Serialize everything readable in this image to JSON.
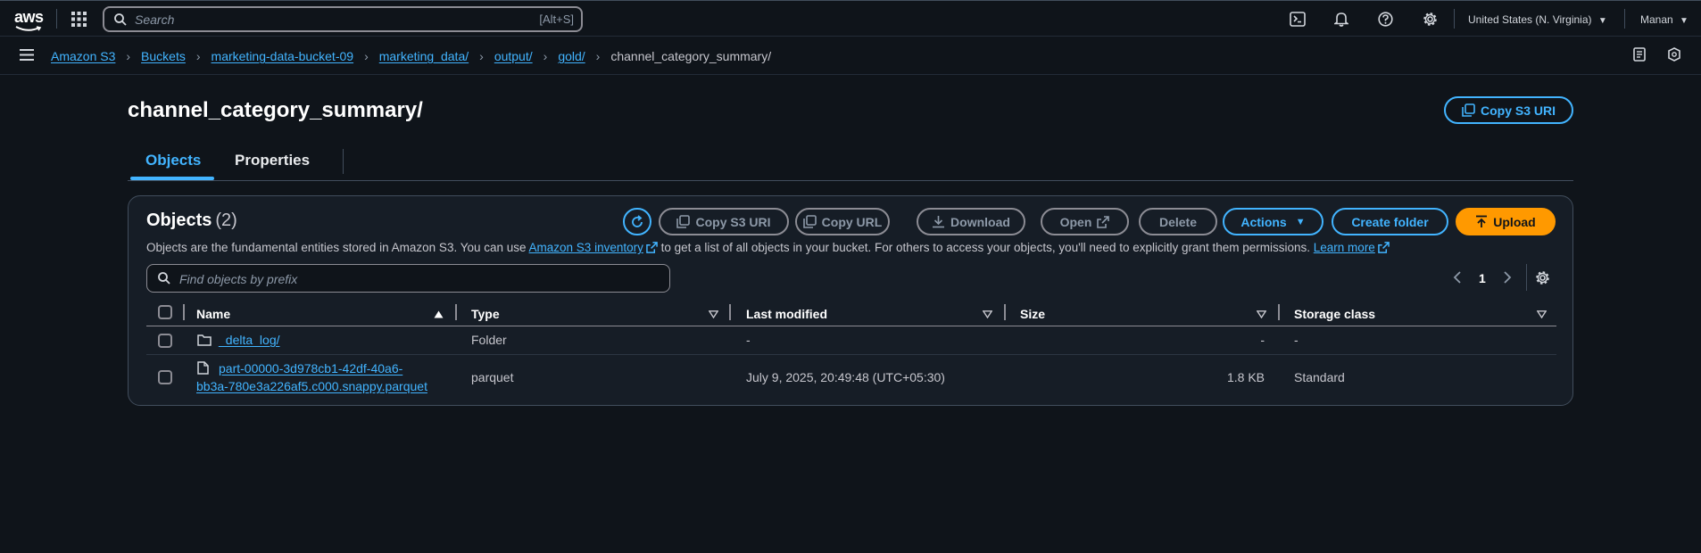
{
  "topbar": {
    "logo_text": "aws",
    "search_placeholder": "Search",
    "search_shortcut": "[Alt+S]",
    "region": "United States (N. Virginia)",
    "user": "Manan"
  },
  "breadcrumbs": [
    {
      "label": "Amazon S3"
    },
    {
      "label": "Buckets"
    },
    {
      "label": "marketing-data-bucket-09"
    },
    {
      "label": "marketing_data/"
    },
    {
      "label": "output/"
    },
    {
      "label": "gold/"
    },
    {
      "label": "channel_category_summary/"
    }
  ],
  "page": {
    "title": "channel_category_summary/",
    "copy_uri_label": "Copy S3 URI"
  },
  "tabs": [
    {
      "label": "Objects",
      "active": true
    },
    {
      "label": "Properties",
      "active": false
    }
  ],
  "objects": {
    "title": "Objects",
    "count": "(2)",
    "desc_before": "Objects are the fundamental entities stored in Amazon S3. You can use ",
    "desc_link": "Amazon S3 inventory",
    "desc_after": " to get a list of all objects in your bucket. For others to access your objects, you'll need to explicitly grant them permissions. ",
    "learn_more": "Learn more",
    "filter_placeholder": "Find objects by prefix",
    "page_number": "1",
    "buttons": {
      "copy_s3_uri": "Copy S3 URI",
      "copy_url": "Copy URL",
      "download": "Download",
      "open": "Open",
      "delete": "Delete",
      "actions": "Actions",
      "create_folder": "Create folder",
      "upload": "Upload"
    },
    "columns": [
      "Name",
      "Type",
      "Last modified",
      "Size",
      "Storage class"
    ],
    "rows": [
      {
        "name": "_delta_log/",
        "type": "Folder",
        "last_modified": "-",
        "size": "-",
        "storage_class": "-",
        "kind": "folder"
      },
      {
        "name_line1": "part-00000-3d978cb1-42df-40a6-",
        "name_line2": "bb3a-780e3a226af5.c000.snappy.parquet",
        "type": "parquet",
        "last_modified": "July 9, 2025, 20:49:48 (UTC+05:30)",
        "size": "1.8 KB",
        "storage_class": "Standard",
        "kind": "file"
      }
    ]
  },
  "colors": {
    "background": "#0f141a",
    "panel": "#161d26",
    "link": "#42b4ff",
    "upload": "#ff9900",
    "border": "#414d5c"
  }
}
